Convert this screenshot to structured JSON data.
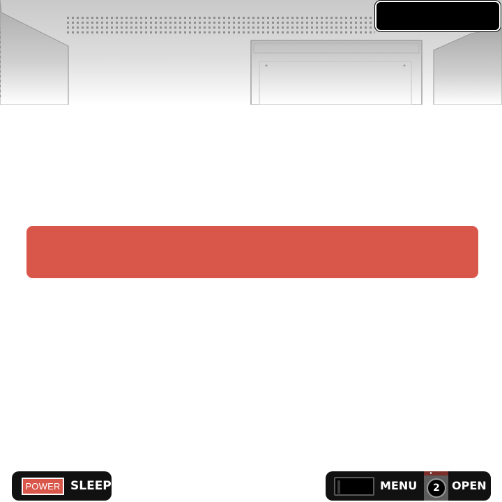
{
  "controls": {
    "power_label": "POWER",
    "sleep_label": "SLEEP",
    "menu_label": "MENU",
    "open_count": "2",
    "open_label": "OPEN"
  },
  "colors": {
    "accent_red": "#d9574a",
    "strip_black": "#111111",
    "background": "#ffffff"
  },
  "icons": {
    "header": "metal-console-panel",
    "counter": "numbered-badge"
  }
}
